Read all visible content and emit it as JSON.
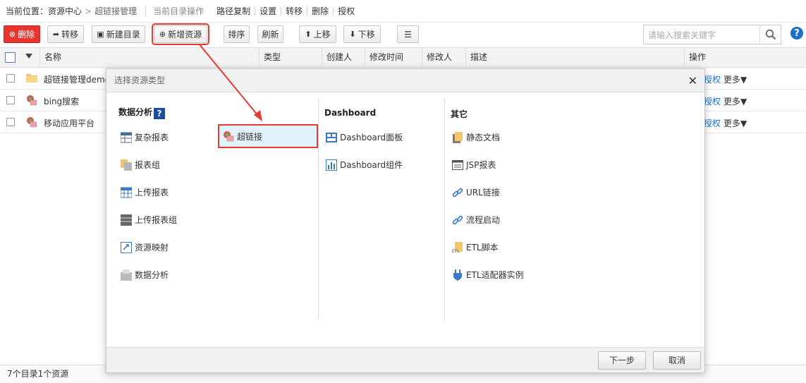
{
  "breadcrumb": {
    "label": "当前位置：",
    "root": "资源中心",
    "separator": ">",
    "current": "超链接管理"
  },
  "dir_ops": {
    "title": "当前目录操作",
    "items": [
      "路径复制",
      "设置",
      "转移",
      "删除",
      "授权"
    ]
  },
  "toolbar": {
    "delete": "删除",
    "move": "转移",
    "new_dir": "新建目录",
    "new_resource": "新增资源",
    "sort": "排序",
    "refresh": "刷新",
    "up": "上移",
    "down": "下移",
    "menu_glyph": "☰",
    "search_placeholder": "请输入搜索关键字"
  },
  "table": {
    "columns": [
      "名称",
      "类型",
      "创建人",
      "修改时间",
      "修改人",
      "描述",
      "操作"
    ],
    "rows": [
      {
        "name": "超链接管理demo",
        "icon": "folder-icon",
        "actions": [
          "授权",
          "更多▼"
        ]
      },
      {
        "name": "bing搜索",
        "icon": "hyperlink-icon",
        "actions": [
          "授权",
          "更多▼"
        ]
      },
      {
        "name": "移动应用平台",
        "icon": "hyperlink-icon",
        "actions": [
          "授权",
          "更多▼"
        ]
      }
    ]
  },
  "status": "7个目录1个资源",
  "dialog": {
    "title": "选择资源类型",
    "sections": {
      "data_analysis": {
        "title": "数据分析",
        "items": [
          "复杂报表",
          "报表组",
          "上传报表",
          "上传报表组",
          "资源映射",
          "数据分析"
        ],
        "items_col2": [
          "超链接"
        ]
      },
      "dashboard": {
        "title": "Dashboard",
        "items": [
          "Dashboard面板",
          "Dashboard组件"
        ]
      },
      "other": {
        "title": "其它",
        "items": [
          "静态文档",
          "JSP报表",
          "URL链接",
          "流程启动",
          "ETL脚本",
          "ETL适配器实例"
        ]
      }
    },
    "next": "下一步",
    "cancel": "取消"
  },
  "colors": {
    "accent_red": "#e53a35",
    "link_blue": "#1a6fc9",
    "selected_bg": "#e2f2fb"
  }
}
